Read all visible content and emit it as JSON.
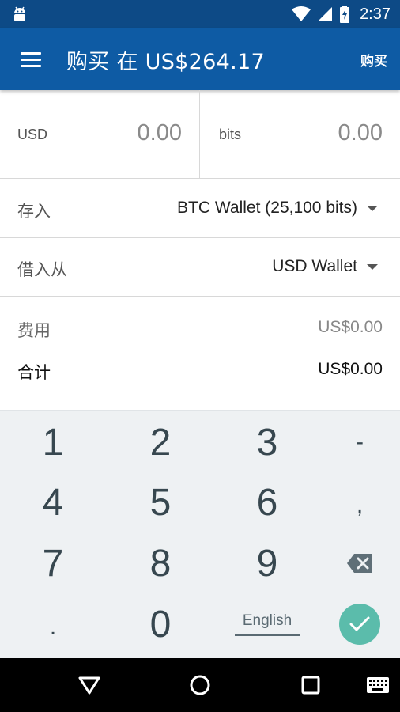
{
  "status_bar": {
    "time": "2:37"
  },
  "app_bar": {
    "title": "购买 在 US$264.17",
    "action_label": "购买"
  },
  "amount": {
    "fiat_currency": "USD",
    "fiat_value": "0.00",
    "crypto_currency": "bits",
    "crypto_value": "0.00"
  },
  "deposit": {
    "label": "存入",
    "selected": "BTC Wallet (25,100 bits)"
  },
  "borrow": {
    "label": "借入从",
    "selected": "USD Wallet"
  },
  "fees": {
    "fee_label": "费用",
    "fee_value": "US$0.00",
    "total_label": "合计",
    "total_value": "US$0.00"
  },
  "keypad": {
    "keys": [
      "1",
      "2",
      "3",
      "-",
      "4",
      "5",
      "6",
      ",",
      "7",
      "8",
      "9",
      ".",
      "0"
    ],
    "language": "English"
  },
  "colors": {
    "status_bar": "#0d4a86",
    "app_bar": "#0e5ba4",
    "done": "#5bbcab",
    "keypad_bg": "#eef1f3"
  }
}
